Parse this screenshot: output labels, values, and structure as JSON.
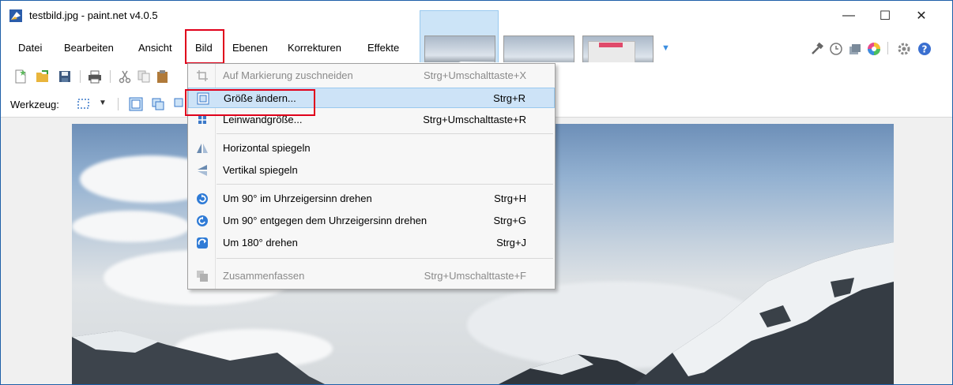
{
  "window": {
    "title": "testbild.jpg - paint.net v4.0.5",
    "minimize": "—",
    "maximize": "☐",
    "close": "✕"
  },
  "menu": {
    "items": [
      "Datei",
      "Bearbeiten",
      "Ansicht",
      "Bild",
      "Ebenen",
      "Korrekturen",
      "Effekte"
    ],
    "active": "Bild"
  },
  "toolbar": {
    "tool_label": "Werkzeug:"
  },
  "dropdown": {
    "items": [
      {
        "label": "Auf Markierung zuschneiden",
        "shortcut": "Strg+Umschalttaste+X",
        "icon": "crop-icon",
        "disabled": true
      },
      {
        "label": "Größe ändern...",
        "shortcut": "Strg+R",
        "icon": "resize-icon",
        "disabled": false,
        "hover": true
      },
      {
        "label": "Leinwandgröße...",
        "shortcut": "Strg+Umschalttaste+R",
        "icon": "canvas-size-icon",
        "disabled": false
      },
      {
        "label": "Horizontal spiegeln",
        "shortcut": "",
        "icon": "flip-horizontal-icon",
        "disabled": false
      },
      {
        "label": "Vertikal spiegeln",
        "shortcut": "",
        "icon": "flip-vertical-icon",
        "disabled": false
      },
      {
        "label": "Um 90° im Uhrzeigersinn drehen",
        "shortcut": "Strg+H",
        "icon": "rotate-cw-icon",
        "disabled": false
      },
      {
        "label": "Um 90° entgegen dem Uhrzeigersinn drehen",
        "shortcut": "Strg+G",
        "icon": "rotate-ccw-icon",
        "disabled": false
      },
      {
        "label": "Um 180° drehen",
        "shortcut": "Strg+J",
        "icon": "rotate-180-icon",
        "disabled": false
      },
      {
        "label": "Zusammenfassen",
        "shortcut": "Strg+Umschalttaste+F",
        "icon": "flatten-icon",
        "disabled": true
      }
    ]
  },
  "colors": {
    "highlight_red": "#e0001b",
    "hover_blue": "#cde3f7",
    "accent_blue": "#3b8ee0"
  }
}
